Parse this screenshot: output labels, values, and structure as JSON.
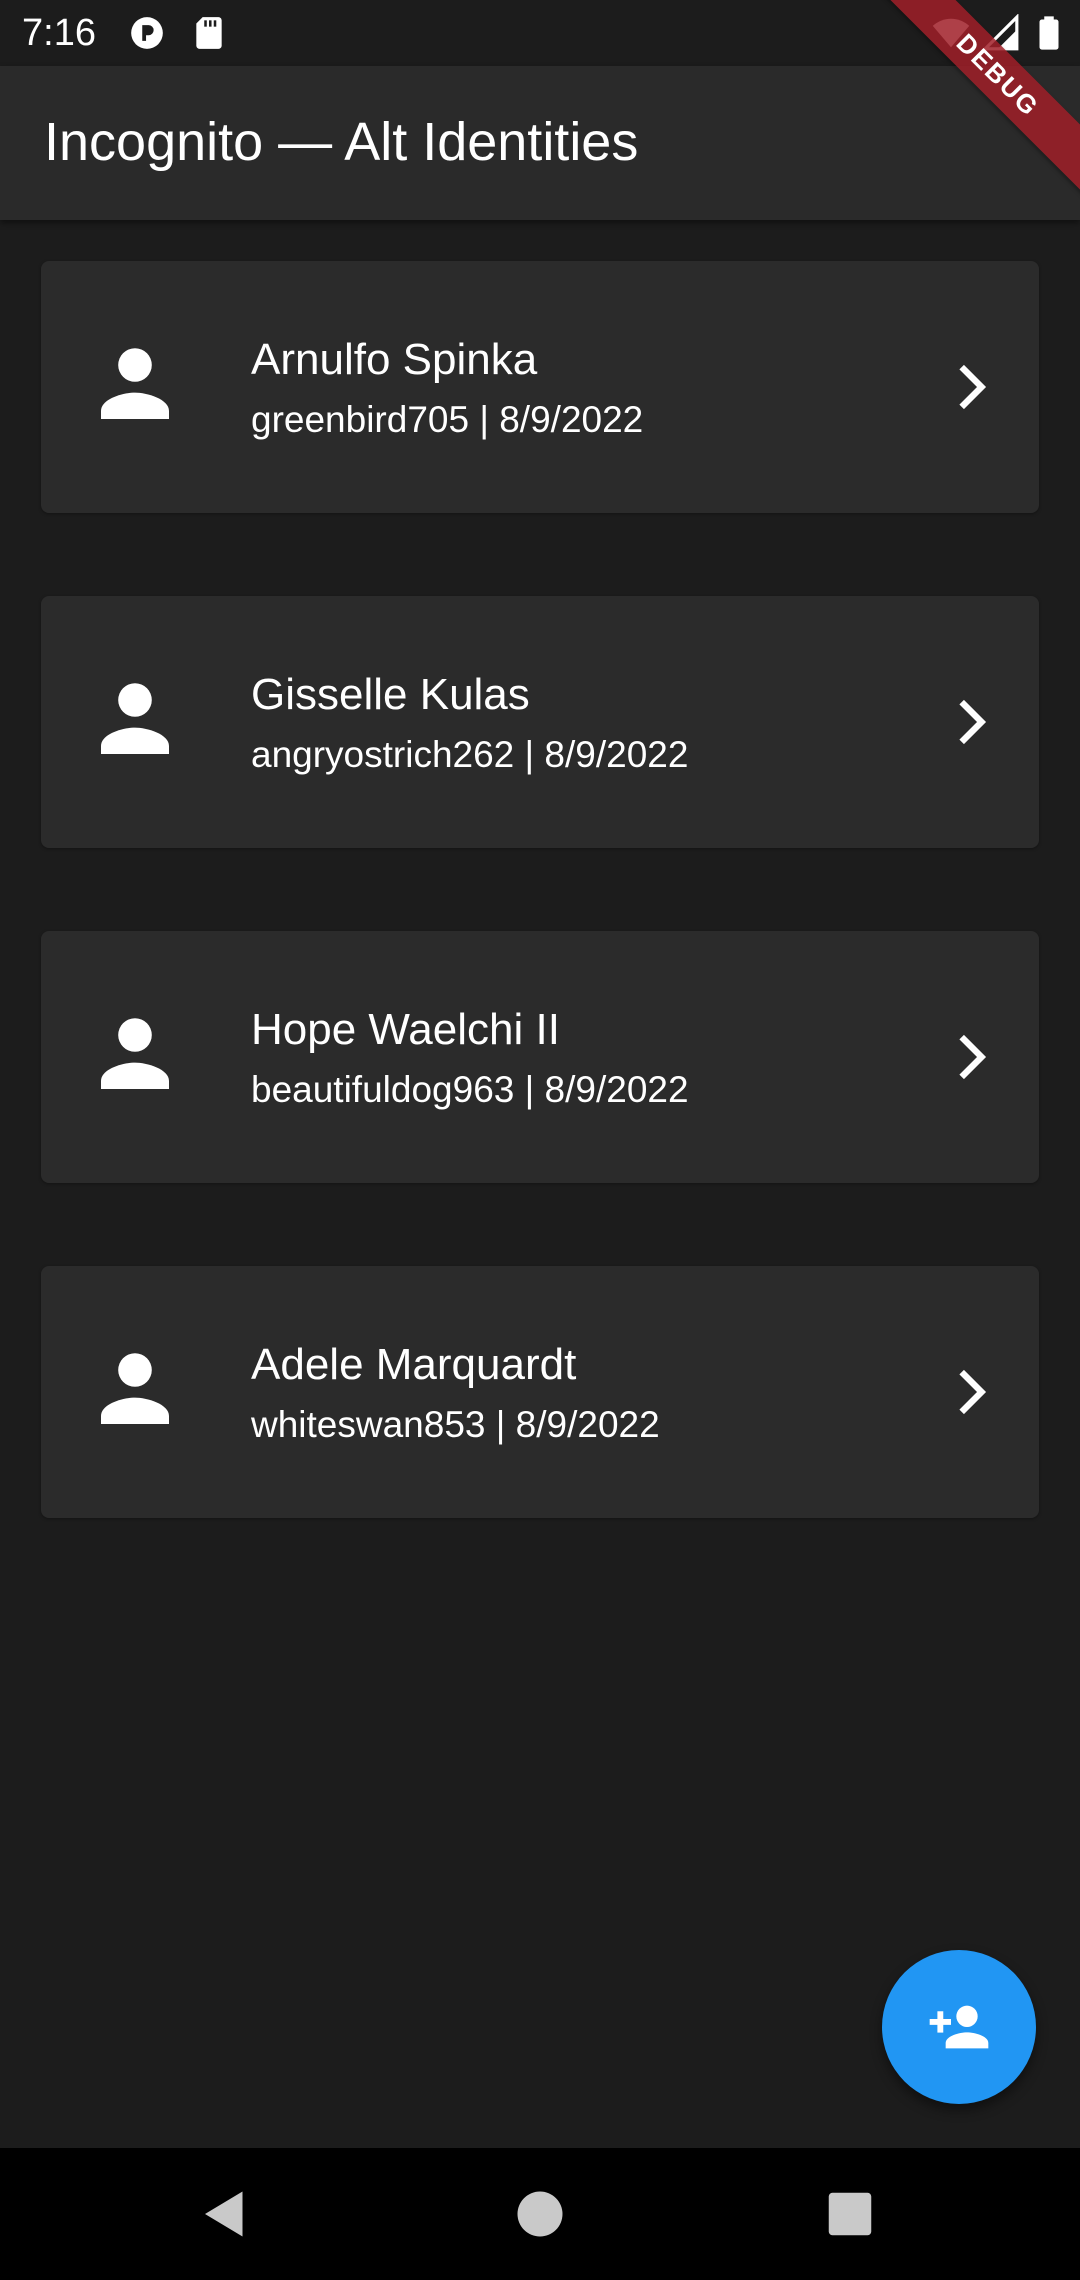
{
  "status_bar": {
    "time": "7:16",
    "icons": [
      "app-notification-icon",
      "sd-card-icon",
      "wifi-icon",
      "signal-icon",
      "battery-icon"
    ]
  },
  "app_bar": {
    "title": "Incognito — Alt Identities"
  },
  "debug_banner": {
    "label": "DEBUG",
    "color": "#a01e28"
  },
  "identities": [
    {
      "name": "Arnulfo Spinka",
      "subtitle": "greenbird705 | 8/9/2022"
    },
    {
      "name": "Gisselle Kulas",
      "subtitle": "angryostrich262 | 8/9/2022"
    },
    {
      "name": "Hope Waelchi II",
      "subtitle": "beautifuldog963 | 8/9/2022"
    },
    {
      "name": "Adele Marquardt",
      "subtitle": "whiteswan853 | 8/9/2022"
    }
  ],
  "fab": {
    "icon": "person-add-icon",
    "color": "#2196f3"
  },
  "nav_bar": {
    "buttons": [
      "back-icon",
      "home-icon",
      "recents-icon"
    ]
  },
  "colors": {
    "background": "#1c1c1c",
    "app_bar": "#2a2a2a",
    "card": "#2b2b2b",
    "text": "#ffffff"
  }
}
